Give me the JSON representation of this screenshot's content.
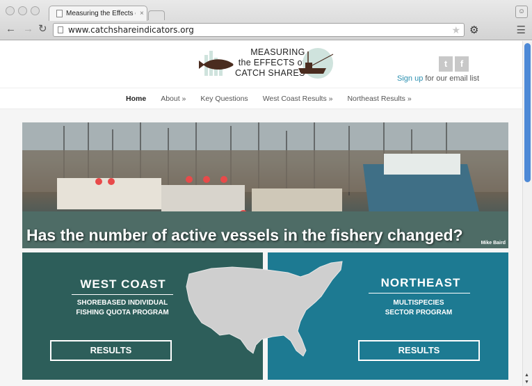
{
  "browser": {
    "tab_title": "Measuring the Effects of Catch Shares",
    "tab_close": "×",
    "url": "www.catchshareindicators.org",
    "back_icon": "back-arrow-icon",
    "forward_icon": "forward-arrow-icon",
    "reload_icon": "reload-icon"
  },
  "header": {
    "logo_line1": "MEASURING",
    "logo_line2": "the EFFECTS of",
    "logo_line3": "CATCH SHARES",
    "twitter": "t",
    "facebook": "f",
    "signup_link": "Sign up",
    "signup_rest": " for our email list"
  },
  "nav": {
    "items": [
      "Home",
      "About »",
      "Key Questions",
      "West Coast Results »",
      "Northeast Results »"
    ],
    "active": "Home"
  },
  "hero": {
    "caption": "Has the number of active vessels in the fishery changed?",
    "credit": "Mike Baird"
  },
  "panels": {
    "west": {
      "title": "WEST COAST",
      "sub1": "SHOREBASED INDIVIDUAL",
      "sub2": "FISHING QUOTA PROGRAM",
      "button": "RESULTS"
    },
    "east": {
      "title": "NORTHEAST",
      "sub1": "MULTISPECIES",
      "sub2": "SECTOR PROGRAM",
      "button": "RESULTS"
    }
  },
  "colors": {
    "west_panel": "#2d5e5a",
    "east_panel": "#1d7a92",
    "link": "#2a8fb0"
  }
}
